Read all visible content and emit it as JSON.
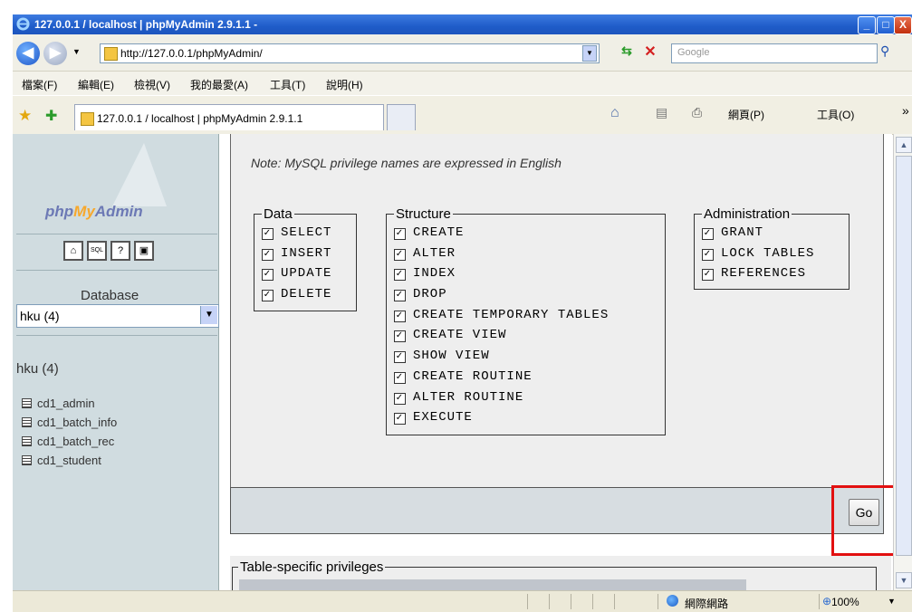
{
  "window": {
    "title": "127.0.0.1 / localhost | phpMyAdmin 2.9.1.1 -",
    "minimize": "_",
    "maximize": "□",
    "close": "X"
  },
  "toolbar": {
    "back": "◀",
    "forward": "▶",
    "address": "http://127.0.0.1/phpMyAdmin/",
    "search_placeholder": "Google"
  },
  "menu": [
    "檔案(F)",
    "編輯(E)",
    "檢視(V)",
    "我的最愛(A)",
    "工具(T)",
    "說明(H)"
  ],
  "tab": {
    "label": "127.0.0.1 / localhost | phpMyAdmin 2.9.1.1"
  },
  "commandbar": {
    "page": "網頁(P)",
    "tools": "工具(O)",
    "more": "»"
  },
  "sidebar": {
    "logo_php": "php",
    "logo_my": "My",
    "logo_admin": "Admin",
    "database_label": "Database",
    "database_selected": "hku (4)",
    "db_heading": "hku (4)",
    "tables": [
      "cd1_admin",
      "cd1_batch_info",
      "cd1_batch_rec",
      "cd1_student"
    ]
  },
  "main": {
    "note": "Note: MySQL privilege names are expressed in English",
    "groups": {
      "data": {
        "legend": "Data",
        "items": [
          "SELECT",
          "INSERT",
          "UPDATE",
          "DELETE"
        ]
      },
      "structure": {
        "legend": "Structure",
        "items": [
          "CREATE",
          "ALTER",
          "INDEX",
          "DROP",
          "CREATE TEMPORARY TABLES",
          "CREATE VIEW",
          "SHOW VIEW",
          "CREATE ROUTINE",
          "ALTER ROUTINE",
          "EXECUTE"
        ]
      },
      "administration": {
        "legend": "Administration",
        "items": [
          "GRANT",
          "LOCK TABLES",
          "REFERENCES"
        ]
      }
    },
    "go_label": "Go",
    "table_specific_legend": "Table-specific privileges"
  },
  "status": {
    "zone": "網際網路",
    "zoom": "100%"
  },
  "colors": {
    "highlight": "#e21010",
    "panel": "#eeeeee",
    "sidebar": "#d0dce0",
    "titlebar": "#1f5cc9"
  }
}
